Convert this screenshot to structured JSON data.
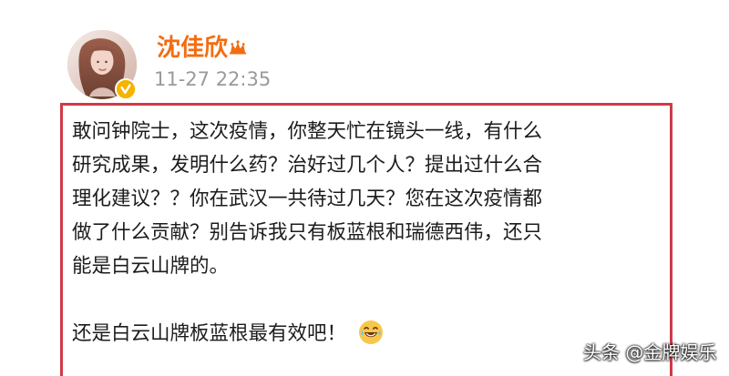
{
  "post": {
    "author": {
      "name": "沈佳欣",
      "timestamp": "11-27 22:35",
      "avatar_icon": "avatar-photo",
      "badge_icon": "verified-badge-icon",
      "title_icon": "crown-icon"
    },
    "body_lines": [
      "敢问钟院士，这次疫情，你整天忙在镜头一线，有什么",
      "研究成果，发明什么药？治好过几个人？提出过什么合",
      "理化建议？？你在武汉一共待过几天？您在这次疫情都",
      "做了什么贡献？别告诉我只有板蓝根和瑞德西伟，还只",
      "能是白云山牌的。",
      "",
      "还是白云山牌板蓝根最有效吧！"
    ],
    "last_line_emoji": "laughing-with-tears-emoji-icon"
  },
  "watermark": {
    "text": "头条 @金牌娱乐"
  },
  "colors": {
    "username": "#f26d12",
    "timestamp": "#9a9a9a",
    "border": "#cf3b48",
    "text": "#1c1c1c",
    "badge": "#f4b400"
  }
}
